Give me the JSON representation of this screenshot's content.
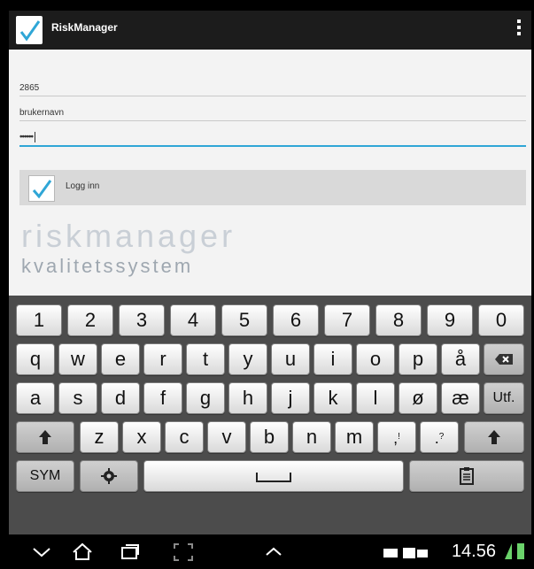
{
  "app": {
    "title": "RiskManager"
  },
  "form": {
    "field1_value": "2865",
    "field2_value": "brukernavn",
    "password_value": "••••••",
    "login_label": "Logg inn"
  },
  "logo": {
    "main": "riskmanager",
    "sub": "kvalitetssystem"
  },
  "keyboard": {
    "row_numbers": [
      "1",
      "2",
      "3",
      "4",
      "5",
      "6",
      "7",
      "8",
      "9",
      "0"
    ],
    "row_q": [
      "q",
      "w",
      "e",
      "r",
      "t",
      "y",
      "u",
      "i",
      "o",
      "p",
      "å"
    ],
    "row_a": [
      "a",
      "s",
      "d",
      "f",
      "g",
      "h",
      "j",
      "k",
      "l",
      "ø",
      "æ"
    ],
    "row_z": [
      "z",
      "x",
      "c",
      "v",
      "b",
      "n",
      "m"
    ],
    "keys": {
      "utf": "Utf.",
      "sym": "SYM"
    }
  },
  "status": {
    "time": "14.56"
  },
  "colors": {
    "accent": "#2fa6d6",
    "topbar": "#1c1c1c",
    "keyboard_bg": "#4c4c4c"
  },
  "icons": {
    "app": "check-icon",
    "overflow": "overflow-menu-icon",
    "login": "check-icon",
    "backspace": "backspace-icon",
    "shift": "shift-icon",
    "settings": "gear-icon",
    "clipboard": "clipboard-icon",
    "nav_back": "back-icon",
    "nav_home": "home-icon",
    "nav_recent": "recent-apps-icon",
    "nav_screenshot": "screenshot-icon",
    "nav_up": "chevron-up-icon"
  }
}
